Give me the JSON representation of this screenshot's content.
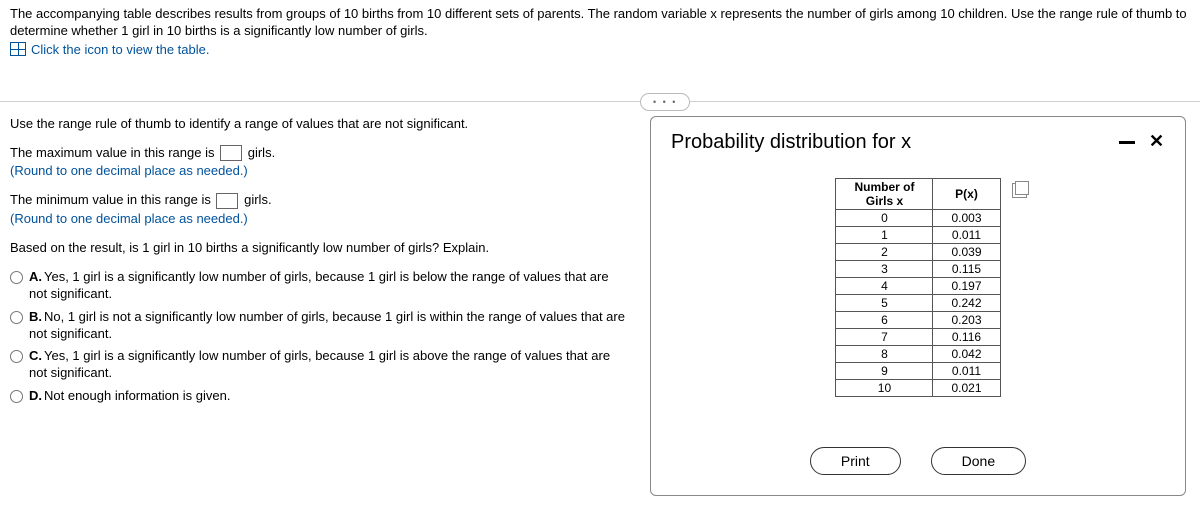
{
  "prompt_text": "The accompanying table describes results from groups of 10 births from 10 different sets of parents. The random variable x represents the number of girls among 10 children. Use the range rule of thumb to determine whether 1 girl in 10 births is a significantly low number of girls.",
  "table_link": "Click the icon to view the table.",
  "dots": "• • •",
  "q1": "Use the range rule of thumb to identify a range of values that are not significant.",
  "max_line_a": "The maximum value in this range is",
  "max_line_b": "girls.",
  "round_note": "(Round to one decimal place as needed.)",
  "min_line_a": "The minimum value in this range is",
  "min_line_b": "girls.",
  "explain_prompt": "Based on the result, is 1 girl in 10 births a significantly low number of girls? Explain.",
  "choices": [
    {
      "letter": "A.",
      "text": "Yes, 1 girl is a significantly low number of girls, because 1 girl is below the range of values that are not significant."
    },
    {
      "letter": "B.",
      "text": "No, 1 girl is not a significantly low number of girls, because 1 girl is within the range of values that are not significant."
    },
    {
      "letter": "C.",
      "text": "Yes, 1 girl is a significantly low number of girls, because 1 girl is above the range of values that are not significant."
    },
    {
      "letter": "D.",
      "text": "Not enough information is given."
    }
  ],
  "panel": {
    "title": "Probability distribution for x",
    "col1_header_a": "Number of",
    "col1_header_b": "Girls x",
    "col2_header": "P(x)",
    "print": "Print",
    "done": "Done"
  },
  "chart_data": {
    "type": "table",
    "columns": [
      "Number of Girls x",
      "P(x)"
    ],
    "rows": [
      [
        0,
        0.003
      ],
      [
        1,
        0.011
      ],
      [
        2,
        0.039
      ],
      [
        3,
        0.115
      ],
      [
        4,
        0.197
      ],
      [
        5,
        0.242
      ],
      [
        6,
        0.203
      ],
      [
        7,
        0.116
      ],
      [
        8,
        0.042
      ],
      [
        9,
        0.011
      ],
      [
        10,
        0.021
      ]
    ]
  }
}
